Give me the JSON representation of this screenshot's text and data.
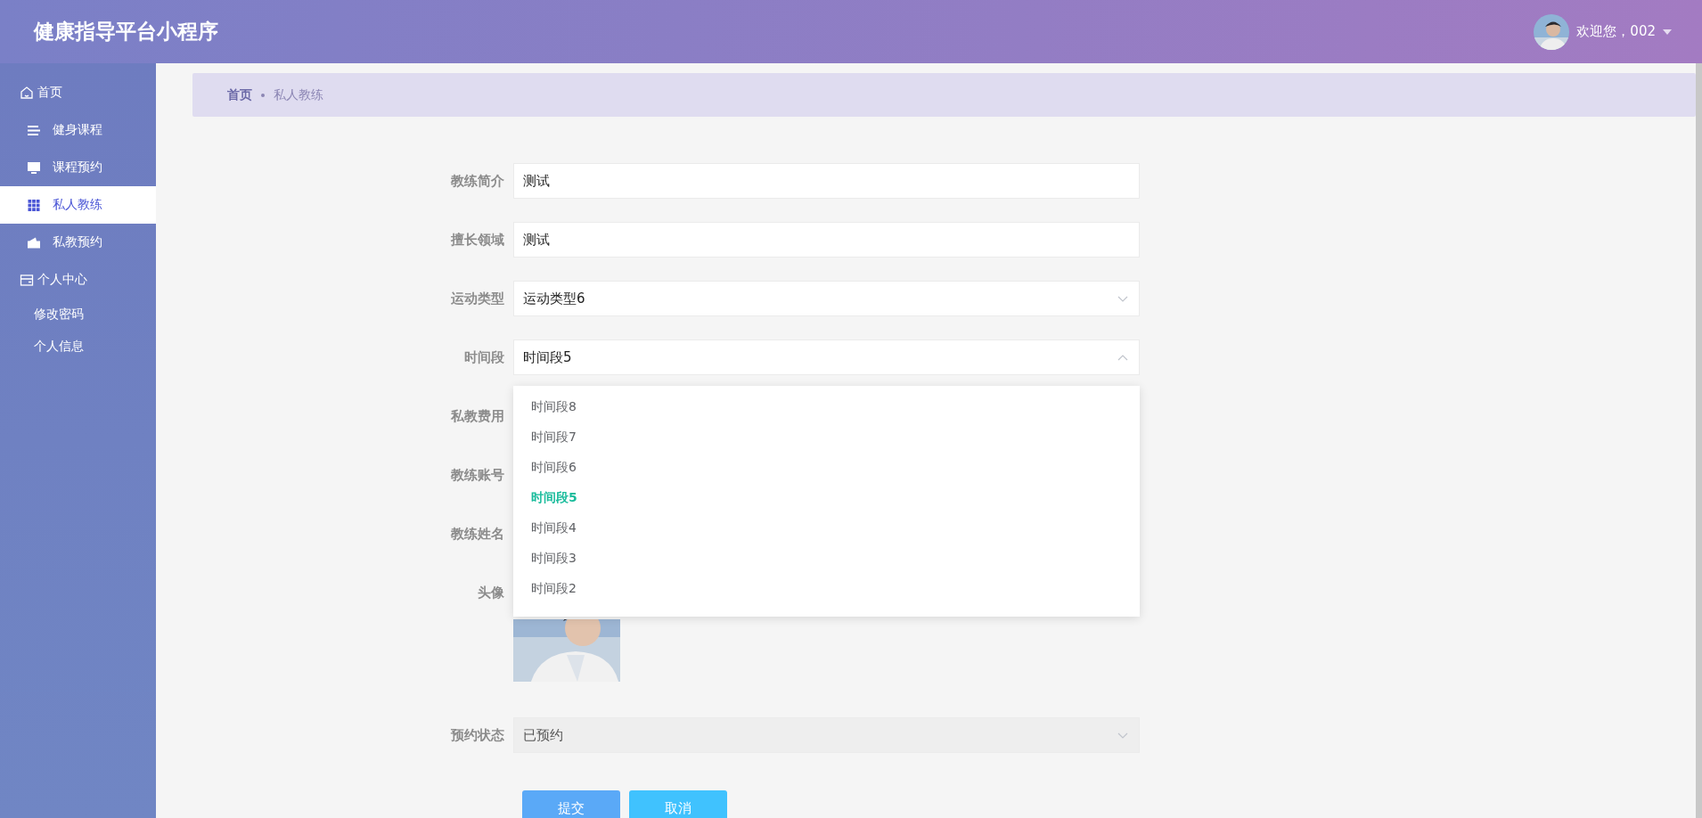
{
  "header": {
    "title": "健康指导平台小程序",
    "greeting": "欢迎您，002"
  },
  "sidebar": {
    "items": [
      {
        "label": "首页",
        "selected": false,
        "children": [
          {
            "label": "健身课程",
            "selected": false
          },
          {
            "label": "课程预约",
            "selected": false
          },
          {
            "label": "私人教练",
            "selected": true
          },
          {
            "label": "私教预约",
            "selected": false
          }
        ]
      },
      {
        "label": "个人中心",
        "selected": false,
        "children": [
          {
            "label": "修改密码",
            "selected": false
          },
          {
            "label": "个人信息",
            "selected": false
          }
        ]
      }
    ]
  },
  "breadcrumb": [
    "首页",
    "私人教练"
  ],
  "form": {
    "fields": [
      {
        "label": "教练简介",
        "kind": "text",
        "value": "测试"
      },
      {
        "label": "擅长领域",
        "kind": "text",
        "value": "测试"
      },
      {
        "label": "运动类型",
        "kind": "select",
        "value": "运动类型6",
        "expanded": false,
        "disabled": false
      },
      {
        "label": "时间段",
        "kind": "select",
        "value": "时间段5",
        "expanded": true,
        "disabled": false,
        "options": [
          {
            "label": "时间段8",
            "selected": false
          },
          {
            "label": "时间段7",
            "selected": false
          },
          {
            "label": "时间段6",
            "selected": false
          },
          {
            "label": "时间段5",
            "selected": true
          },
          {
            "label": "时间段4",
            "selected": false
          },
          {
            "label": "时间段3",
            "selected": false
          },
          {
            "label": "时间段2",
            "selected": false
          }
        ]
      },
      {
        "label": "私教费用",
        "kind": "covered"
      },
      {
        "label": "教练账号",
        "kind": "covered"
      },
      {
        "label": "教练姓名",
        "kind": "covered"
      },
      {
        "label": "头像"
      },
      {
        "label": "预约状态",
        "kind": "select",
        "value": "已预约",
        "expanded": false,
        "disabled": true
      }
    ]
  },
  "buttons": [
    {
      "label": "提交",
      "kind": "primary"
    },
    {
      "label": "取消",
      "kind": "info"
    }
  ]
}
